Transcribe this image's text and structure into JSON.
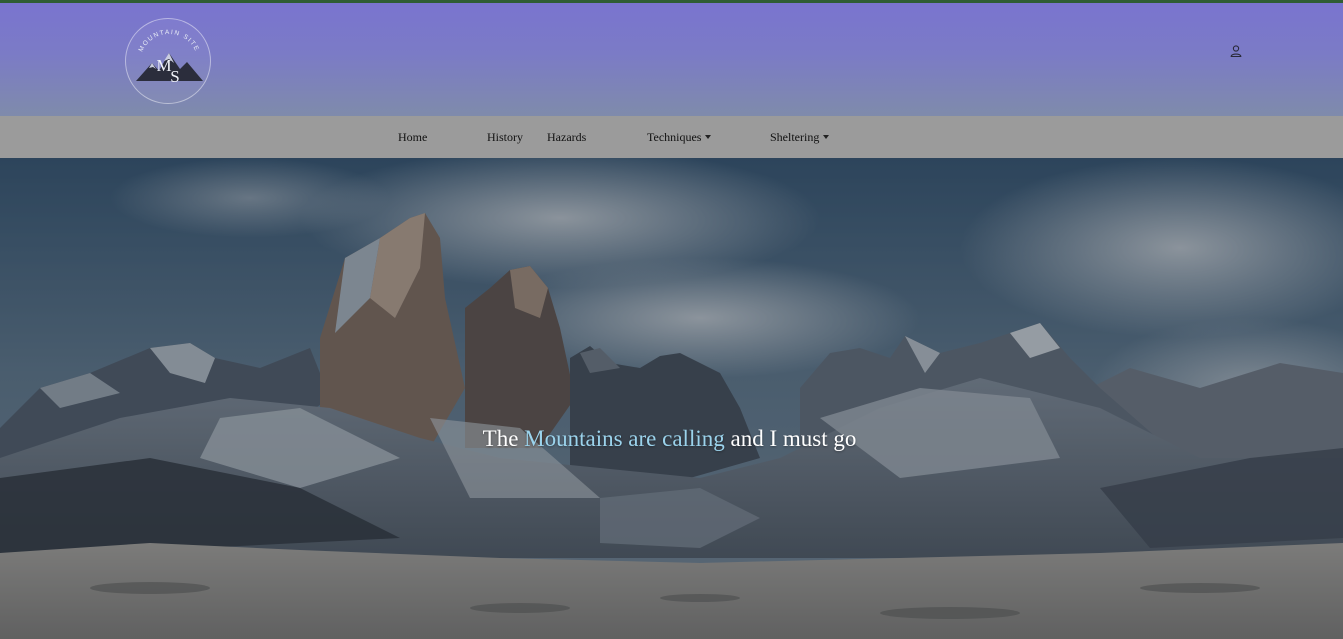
{
  "logo": {
    "text": "MOUNTAIN SITE",
    "monogram_m": "M",
    "monogram_s": "S"
  },
  "header": {
    "user_icon": "user-icon"
  },
  "nav": {
    "home": "Home",
    "history": "History",
    "hazards": "Hazards",
    "techniques": "Techniques",
    "sheltering": "Sheltering"
  },
  "hero": {
    "tagline_pre": "The ",
    "tagline_highlight": "Mountains are calling",
    "tagline_post": " and I must go"
  },
  "colors": {
    "header_top": "#7a74cf",
    "header_bottom": "#7f8bab",
    "topline": "#2f5d34",
    "navbar": "#9b9b9b",
    "highlight": "#9bd3ec"
  }
}
